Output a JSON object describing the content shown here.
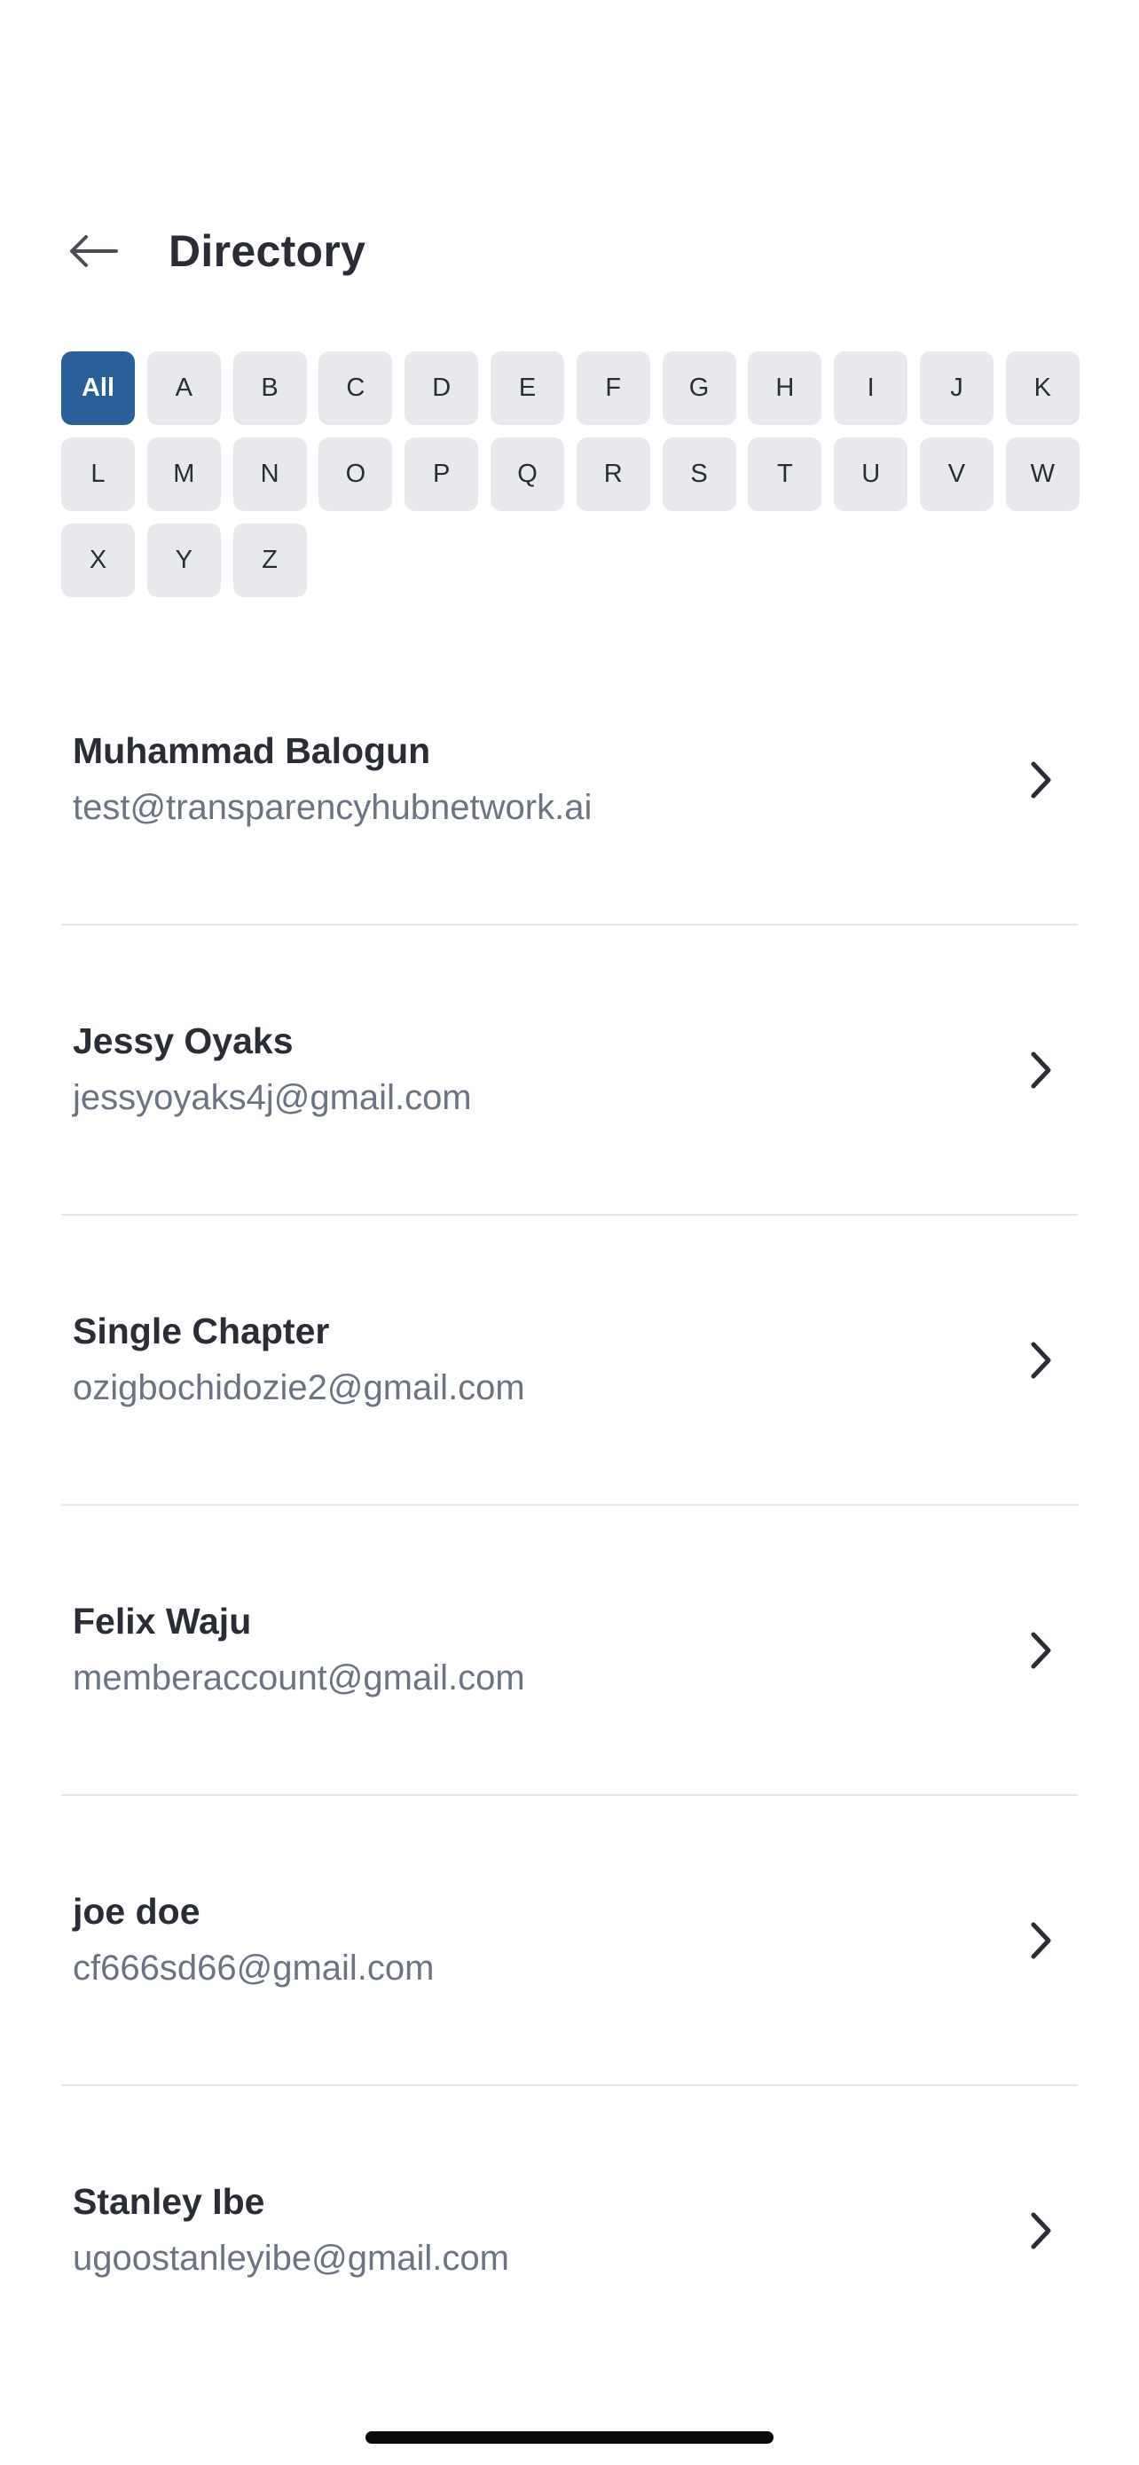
{
  "header": {
    "title": "Directory",
    "back_icon": "arrow-left-icon"
  },
  "alphabet": {
    "selected": "All",
    "letters": [
      "All",
      "A",
      "B",
      "C",
      "D",
      "E",
      "F",
      "G",
      "H",
      "I",
      "J",
      "K",
      "L",
      "M",
      "N",
      "O",
      "P",
      "Q",
      "R",
      "S",
      "T",
      "U",
      "V",
      "W",
      "X",
      "Y",
      "Z"
    ]
  },
  "colors": {
    "accent": "#29609a",
    "chip_bg": "#e8e9ec",
    "text_primary": "#2a2d36",
    "text_secondary": "#6c7484",
    "divider": "#e6e7ea"
  },
  "members": [
    {
      "name": "Muhammad Balogun",
      "email": "test@transparencyhubnetwork.ai"
    },
    {
      "name": "Jessy Oyaks",
      "email": "jessyoyaks4j@gmail.com"
    },
    {
      "name": "Single Chapter",
      "email": "ozigbochidozie2@gmail.com"
    },
    {
      "name": "Felix Waju",
      "email": "memberaccount@gmail.com"
    },
    {
      "name": "joe doe",
      "email": "cf666sd66@gmail.com"
    },
    {
      "name": "Stanley Ibe",
      "email": "ugoostanleyibe@gmail.com"
    }
  ]
}
